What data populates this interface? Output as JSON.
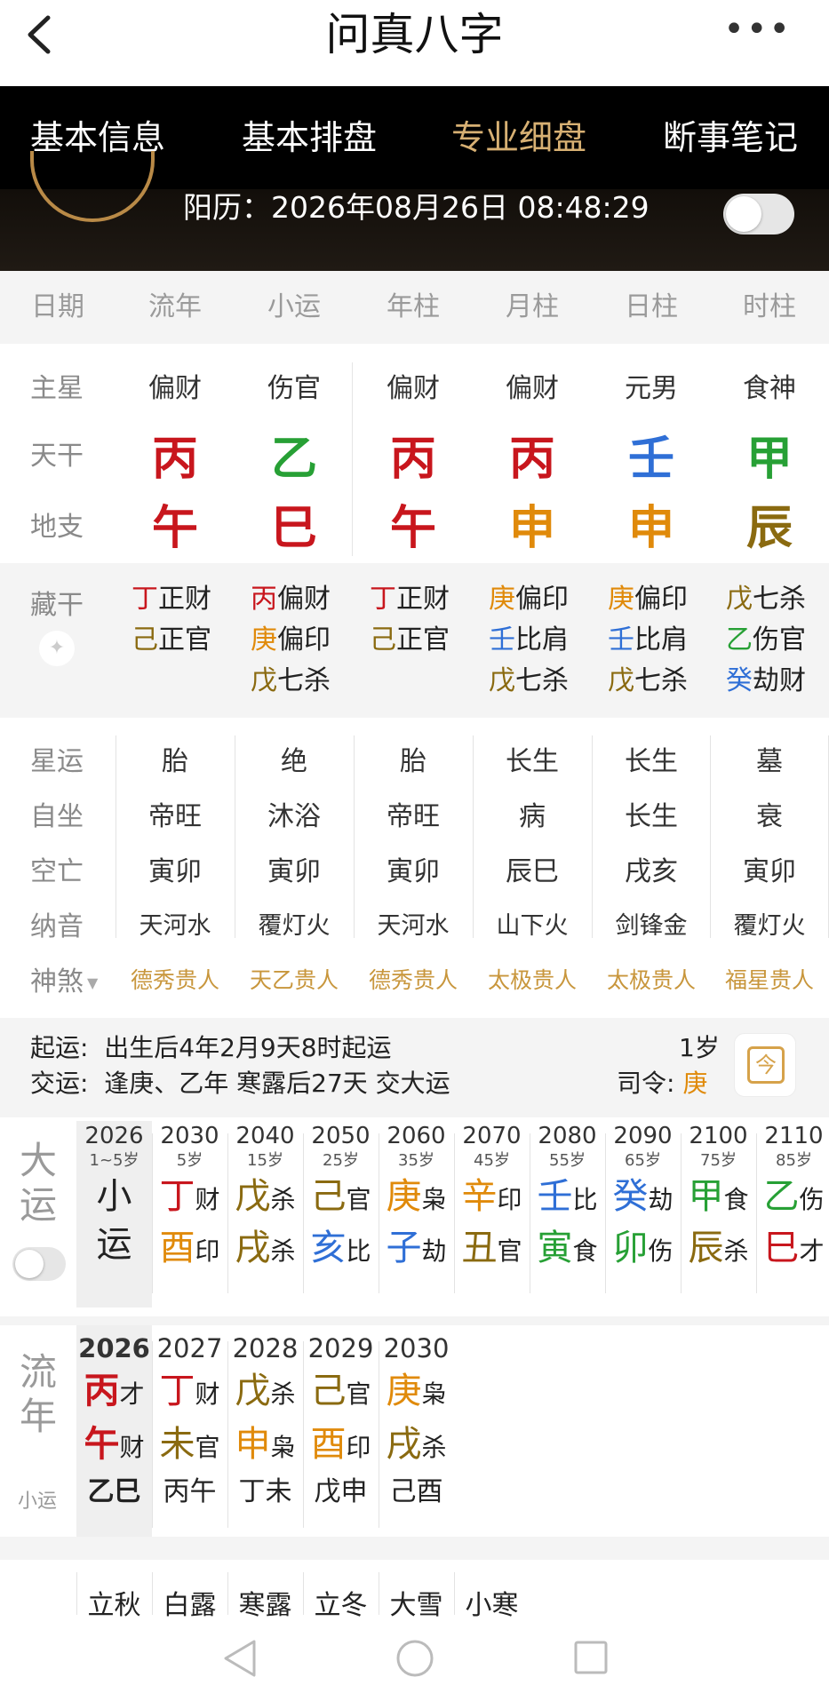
{
  "title": "问真八字",
  "tabs": [
    "基本信息",
    "基本排盘",
    "专业细盘",
    "断事笔记"
  ],
  "active_tab": 2,
  "solar_label": "阳历：2026年08月26日 08:48:29",
  "columns": [
    "日期",
    "流年",
    "小运",
    "年柱",
    "月柱",
    "日柱",
    "时柱"
  ],
  "row_labels": {
    "main_star": "主星",
    "stem": "天干",
    "branch": "地支",
    "hidden": "藏干",
    "star_luck": "星运",
    "self_seat": "自坐",
    "void": "空亡",
    "nayin": "纳音",
    "shensha": "神煞"
  },
  "main_stars": [
    "偏财",
    "伤官",
    "偏财",
    "偏财",
    "元男",
    "食神"
  ],
  "stems": [
    {
      "t": "丙",
      "color": "red"
    },
    {
      "t": "乙",
      "color": "green"
    },
    {
      "t": "丙",
      "color": "red"
    },
    {
      "t": "丙",
      "color": "red"
    },
    {
      "t": "壬",
      "color": "blue"
    },
    {
      "t": "甲",
      "color": "green"
    }
  ],
  "branches": [
    {
      "t": "午",
      "color": "red"
    },
    {
      "t": "巳",
      "color": "red"
    },
    {
      "t": "午",
      "color": "red"
    },
    {
      "t": "申",
      "color": "orange"
    },
    {
      "t": "申",
      "color": "orange"
    },
    {
      "t": "辰",
      "color": "brown"
    }
  ],
  "hidden_stems": [
    [
      {
        "s": "丁",
        "c": "red",
        "g": "正财"
      },
      {
        "s": "己",
        "c": "brown",
        "g": "正官"
      }
    ],
    [
      {
        "s": "丙",
        "c": "red",
        "g": "偏财"
      },
      {
        "s": "庚",
        "c": "orange",
        "g": "偏印"
      },
      {
        "s": "戊",
        "c": "brown",
        "g": "七杀"
      }
    ],
    [
      {
        "s": "丁",
        "c": "red",
        "g": "正财"
      },
      {
        "s": "己",
        "c": "brown",
        "g": "正官"
      }
    ],
    [
      {
        "s": "庚",
        "c": "orange",
        "g": "偏印"
      },
      {
        "s": "壬",
        "c": "blue",
        "g": "比肩"
      },
      {
        "s": "戊",
        "c": "brown",
        "g": "七杀"
      }
    ],
    [
      {
        "s": "庚",
        "c": "orange",
        "g": "偏印"
      },
      {
        "s": "壬",
        "c": "blue",
        "g": "比肩"
      },
      {
        "s": "戊",
        "c": "brown",
        "g": "七杀"
      }
    ],
    [
      {
        "s": "戊",
        "c": "brown",
        "g": "七杀"
      },
      {
        "s": "乙",
        "c": "green",
        "g": "伤官"
      },
      {
        "s": "癸",
        "c": "blue",
        "g": "劫财"
      }
    ]
  ],
  "star_luck": [
    "胎",
    "绝",
    "胎",
    "长生",
    "长生",
    "墓"
  ],
  "self_seat": [
    "帝旺",
    "沐浴",
    "帝旺",
    "病",
    "长生",
    "衰"
  ],
  "void": [
    "寅卯",
    "寅卯",
    "寅卯",
    "辰巳",
    "戌亥",
    "寅卯"
  ],
  "nayin": [
    "天河水",
    "覆灯火",
    "天河水",
    "山下火",
    "剑锋金",
    "覆灯火"
  ],
  "shensha": [
    "德秀贵人",
    "天乙贵人",
    "德秀贵人",
    "太极贵人",
    "太极贵人",
    "福星贵人"
  ],
  "qiyun": {
    "line1_label": "起运:",
    "line1": "出生后4年2月9天8时起运",
    "line2_label": "交运:",
    "line2": "逢庚、乙年 寒露后27天 交大运",
    "age": "1岁",
    "siling_label": "司令:",
    "siling": "庚"
  },
  "calendar_icon": "今",
  "dayun_label": [
    "大",
    "运"
  ],
  "dayun": [
    {
      "year": "2026",
      "age": "1~5岁",
      "xiao": true,
      "top": "小",
      "bot": "运"
    },
    {
      "year": "2030",
      "age": "5岁",
      "s1": "丁",
      "c1": "red",
      "g1": "财",
      "s2": "酉",
      "c2": "orange",
      "g2": "印"
    },
    {
      "year": "2040",
      "age": "15岁",
      "s1": "戊",
      "c1": "brown",
      "g1": "杀",
      "s2": "戌",
      "c2": "brown",
      "g2": "杀"
    },
    {
      "year": "2050",
      "age": "25岁",
      "s1": "己",
      "c1": "brown",
      "g1": "官",
      "s2": "亥",
      "c2": "blue",
      "g2": "比"
    },
    {
      "year": "2060",
      "age": "35岁",
      "s1": "庚",
      "c1": "orange",
      "g1": "枭",
      "s2": "子",
      "c2": "blue",
      "g2": "劫"
    },
    {
      "year": "2070",
      "age": "45岁",
      "s1": "辛",
      "c1": "orange",
      "g1": "印",
      "s2": "丑",
      "c2": "brown",
      "g2": "官"
    },
    {
      "year": "2080",
      "age": "55岁",
      "s1": "壬",
      "c1": "blue",
      "g1": "比",
      "s2": "寅",
      "c2": "green",
      "g2": "食"
    },
    {
      "year": "2090",
      "age": "65岁",
      "s1": "癸",
      "c1": "blue",
      "g1": "劫",
      "s2": "卯",
      "c2": "green",
      "g2": "伤"
    },
    {
      "year": "2100",
      "age": "75岁",
      "s1": "甲",
      "c1": "green",
      "g1": "食",
      "s2": "辰",
      "c2": "brown",
      "g2": "杀"
    },
    {
      "year": "2110",
      "age": "85岁",
      "s1": "乙",
      "c1": "green",
      "g1": "伤",
      "s2": "巳",
      "c2": "red",
      "g2": "才"
    }
  ],
  "liunian_label": [
    "流",
    "年"
  ],
  "liunian_sub": "小运",
  "liunian": [
    {
      "year": "2026",
      "s1": "丙",
      "c1": "red",
      "g1": "才",
      "s2": "午",
      "c2": "red",
      "g2": "财",
      "xy": "乙巳"
    },
    {
      "year": "2027",
      "s1": "丁",
      "c1": "red",
      "g1": "财",
      "s2": "未",
      "c2": "brown",
      "g2": "官",
      "xy": "丙午"
    },
    {
      "year": "2028",
      "s1": "戊",
      "c1": "brown",
      "g1": "杀",
      "s2": "申",
      "c2": "orange",
      "g2": "枭",
      "xy": "丁未"
    },
    {
      "year": "2029",
      "s1": "己",
      "c1": "brown",
      "g1": "官",
      "s2": "酉",
      "c2": "orange",
      "g2": "印",
      "xy": "戊申"
    },
    {
      "year": "2030",
      "s1": "庚",
      "c1": "orange",
      "g1": "枭",
      "s2": "戌",
      "c2": "brown",
      "g2": "杀",
      "xy": "己酉"
    }
  ],
  "jieqi": [
    "立秋",
    "白露",
    "寒露",
    "立冬",
    "大雪",
    "小寒"
  ],
  "colors": {
    "red": "#c8161d",
    "green": "#27a035",
    "blue": "#2f6fd6",
    "orange": "#e08a0a",
    "brown": "#8a6a10",
    "gold": "#c8963c",
    "tab_active": "#d7b073"
  }
}
